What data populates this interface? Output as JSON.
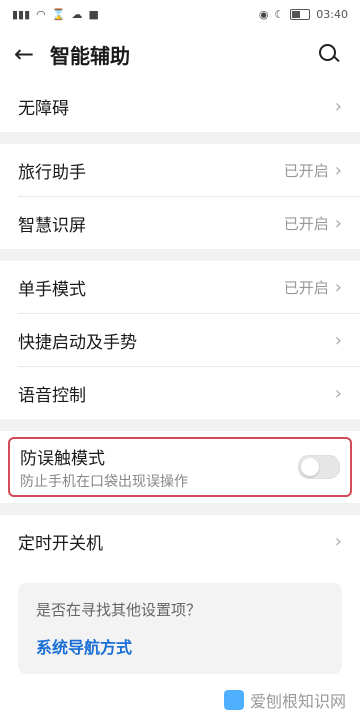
{
  "status": {
    "time": "03:40",
    "icons_left": [
      "signal-icon",
      "wifi-icon",
      "hourglass-icon",
      "cloud-icon",
      "app-icon"
    ],
    "icons_right": [
      "eye-icon",
      "moon-icon",
      "battery-icon"
    ]
  },
  "header": {
    "back_label": "←",
    "title": "智能辅助",
    "search_icon": "search-icon"
  },
  "sections": {
    "accessibility": {
      "label": "无障碍"
    },
    "travel": {
      "label": "旅行助手",
      "value": "已开启"
    },
    "smart_screen": {
      "label": "智慧识屏",
      "value": "已开启"
    },
    "one_hand": {
      "label": "单手模式",
      "value": "已开启"
    },
    "shortcuts": {
      "label": "快捷启动及手势"
    },
    "voice": {
      "label": "语音控制"
    },
    "anti_touch": {
      "label": "防误触模式",
      "sub": "防止手机在口袋出现误操作",
      "enabled": false
    },
    "schedule_power": {
      "label": "定时开关机"
    }
  },
  "card": {
    "question": "是否在寻找其他设置项？",
    "link": "系统导航方式"
  },
  "watermark": {
    "text": "爱刨根知识网"
  },
  "colors": {
    "highlight_border": "#d14b58",
    "link": "#1a6fd6"
  }
}
